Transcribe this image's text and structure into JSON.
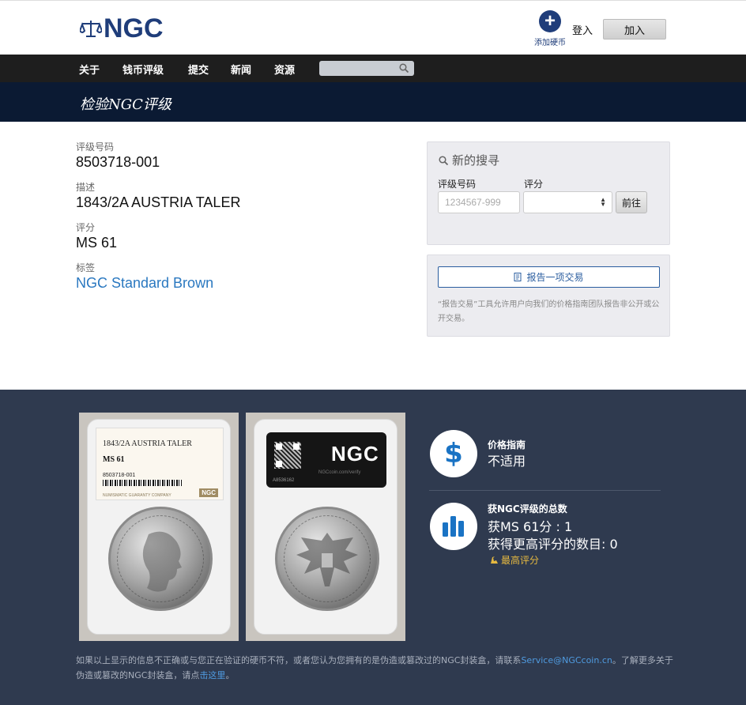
{
  "brand": {
    "logo_text": "NGC",
    "primary_color": "#1f3d7a"
  },
  "header": {
    "add_coin_label": "添加硬币",
    "login_label": "登入",
    "join_label": "加入"
  },
  "nav": {
    "items": [
      "关于",
      "钱币评级",
      "提交",
      "新闻",
      "资源"
    ],
    "search_placeholder": ""
  },
  "banner": {
    "title": "检验NGC评级"
  },
  "details": {
    "cert_label": "评级号码",
    "cert_value": "8503718-001",
    "desc_label": "描述",
    "desc_value": "1843/2A AUSTRIA TALER",
    "grade_label": "评分",
    "grade_value": "MS 61",
    "holder_label": "标签",
    "holder_value": "NGC Standard Brown"
  },
  "search_panel": {
    "title": "新的搜寻",
    "cert_label": "评级号码",
    "grade_label": "评分",
    "cert_placeholder": "1234567-999",
    "grade_selected": "",
    "go_label": "前往"
  },
  "report_panel": {
    "button_label": "报告一项交易",
    "note": "“报告交易”工具允许用户向我们的价格指南团队报告非公开或公开交易。"
  },
  "slab": {
    "front_desc": "1843/2A AUSTRIA TALER",
    "front_grade": "MS 61",
    "front_cert": "8503718-001",
    "front_company": "NUMISMATIC GUARANTY COMPANY",
    "front_mini_logo": "NGC",
    "back_logo": "NGC",
    "back_url": "NGCcoin.com/verify",
    "back_serial": "A8536162"
  },
  "stats": {
    "price_label": "价格指南",
    "price_value": "不适用",
    "pop_label": "获NGC评级的总数",
    "pop_grade_line": "获MS 61分 : 1",
    "pop_higher_line": "获得更高评分的数目: 0",
    "top_pop_label": "最高评分"
  },
  "footer": {
    "text_before_email": "如果以上显示的信息不正确或与您正在验证的硬币不符，或者您认为您拥有的是伪造或篡改过的NGC封装盒，请联系",
    "email": "Service@NGCcoin.cn",
    "text_after_email": "。了解更多关于伪造或篡改的NGC封装盒，请点",
    "link_text": "击这里",
    "text_end": "。"
  },
  "colors": {
    "nav_bg": "#1e1e1e",
    "banner_bg": "#0b1a33",
    "dark_bg": "#2f3a4f",
    "link": "#2a78c0",
    "icon_blue": "#1a73c4",
    "top_pop": "#e6b940"
  }
}
